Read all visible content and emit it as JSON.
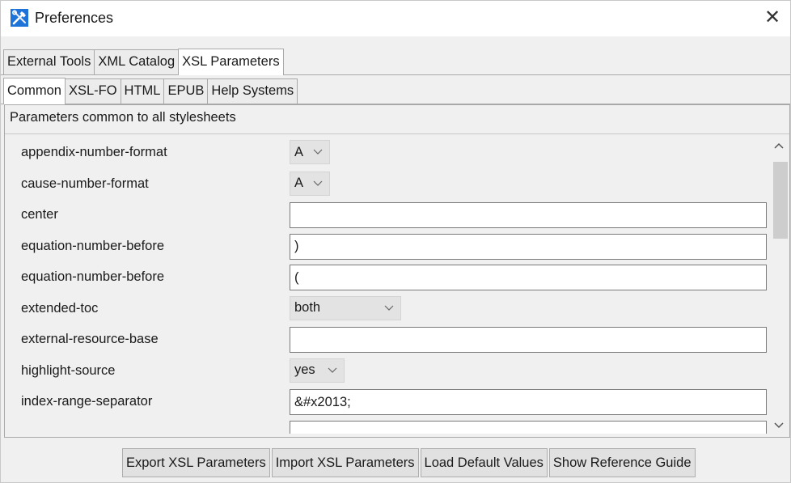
{
  "window": {
    "title": "Preferences",
    "app_icon": "tools-icon",
    "close_glyph": "✕"
  },
  "top_tabs": [
    {
      "label": "External Tools",
      "active": false
    },
    {
      "label": "XML Catalog",
      "active": false
    },
    {
      "label": "XSL Parameters",
      "active": true
    }
  ],
  "sub_tabs": [
    {
      "label": "Common",
      "active": true
    },
    {
      "label": "XSL-FO",
      "active": false
    },
    {
      "label": "HTML",
      "active": false
    },
    {
      "label": "EPUB",
      "active": false
    },
    {
      "label": "Help Systems",
      "active": false
    }
  ],
  "panel": {
    "description": "Parameters common to all stylesheets"
  },
  "parameters": [
    {
      "name": "appendix-number-format",
      "control": "select",
      "value": "A"
    },
    {
      "name": "cause-number-format",
      "control": "select",
      "value": "A"
    },
    {
      "name": "center",
      "control": "text",
      "value": ""
    },
    {
      "name": "equation-number-before",
      "control": "text",
      "value": ")"
    },
    {
      "name": "equation-number-before",
      "control": "text",
      "value": "("
    },
    {
      "name": "extended-toc",
      "control": "select",
      "value": "both"
    },
    {
      "name": "external-resource-base",
      "control": "text",
      "value": ""
    },
    {
      "name": "highlight-source",
      "control": "select",
      "value": "yes"
    },
    {
      "name": "index-range-separator",
      "control": "text",
      "value": "&#x2013;"
    },
    {
      "name": "",
      "control": "text",
      "value": ""
    }
  ],
  "buttons": {
    "export": "Export XSL Parameters",
    "import": "Import XSL Parameters",
    "defaults": "Load Default Values",
    "reference": "Show Reference Guide"
  },
  "colors": {
    "accent": "#1e88e5",
    "icon_bg": "#1e73d8",
    "window_bg": "#f0f0f0"
  }
}
